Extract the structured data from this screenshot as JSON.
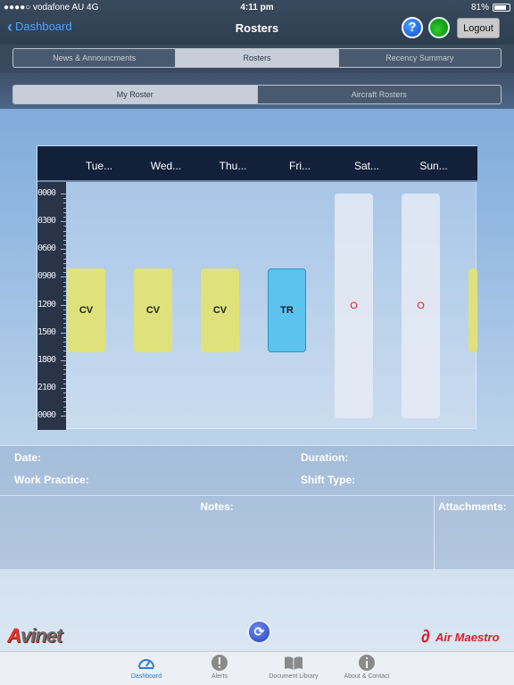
{
  "status": {
    "carrier": "●●●●○ vodafone AU  4G",
    "time": "4:11 pm",
    "battery": "81%",
    "battery_level": 0.81
  },
  "nav": {
    "back_label": "Dashboard",
    "title": "Rosters",
    "logout_label": "Logout",
    "help_glyph": "?"
  },
  "top_tabs": [
    {
      "label": "News & Announcments",
      "active": false
    },
    {
      "label": "Rosters",
      "active": true
    },
    {
      "label": "Recency Summary",
      "active": false
    }
  ],
  "sub_tabs": [
    {
      "label": "My Roster",
      "active": true
    },
    {
      "label": "Aircraft Rosters",
      "active": false
    }
  ],
  "roster": {
    "days": [
      "Tue...",
      "Wed...",
      "Thu...",
      "Fri...",
      "Sat...",
      "Sun..."
    ],
    "times": [
      "0000",
      "0300",
      "0600",
      "0900",
      "1200",
      "1500",
      "1800",
      "2100",
      "0000"
    ],
    "blocks": [
      {
        "day": 0,
        "code": "CV",
        "kind": "cv",
        "start": 8.0,
        "end": 17.0
      },
      {
        "day": 1,
        "code": "CV",
        "kind": "cv",
        "start": 8.0,
        "end": 17.0
      },
      {
        "day": 2,
        "code": "CV",
        "kind": "cv",
        "start": 8.0,
        "end": 17.0
      },
      {
        "day": 3,
        "code": "TR",
        "kind": "tr",
        "start": 8.0,
        "end": 17.0
      },
      {
        "day": 4,
        "code": "O",
        "kind": "off",
        "start": 0,
        "end": 24
      },
      {
        "day": 5,
        "code": "O",
        "kind": "off",
        "start": 0,
        "end": 24
      },
      {
        "day": 6,
        "code": "",
        "kind": "cv",
        "start": 9.0,
        "end": 17.0
      }
    ]
  },
  "details": {
    "date_label": "Date:",
    "duration_label": "Duration:",
    "work_practice_label": "Work Practice:",
    "shift_type_label": "Shift Type:",
    "notes_label": "Notes:",
    "attachments_label": "Attachments:"
  },
  "logos": {
    "avinet_a": "A",
    "avinet_rest": "vinet",
    "airmaestro": "Air Maestro"
  },
  "tabbar": [
    {
      "label": "Dashboard",
      "icon": "gauge-icon",
      "active": true
    },
    {
      "label": "Alerts",
      "icon": "alert-icon",
      "active": false
    },
    {
      "label": "Document Library",
      "icon": "book-icon",
      "active": false
    },
    {
      "label": "About & Contact",
      "icon": "info-icon",
      "active": false
    }
  ]
}
